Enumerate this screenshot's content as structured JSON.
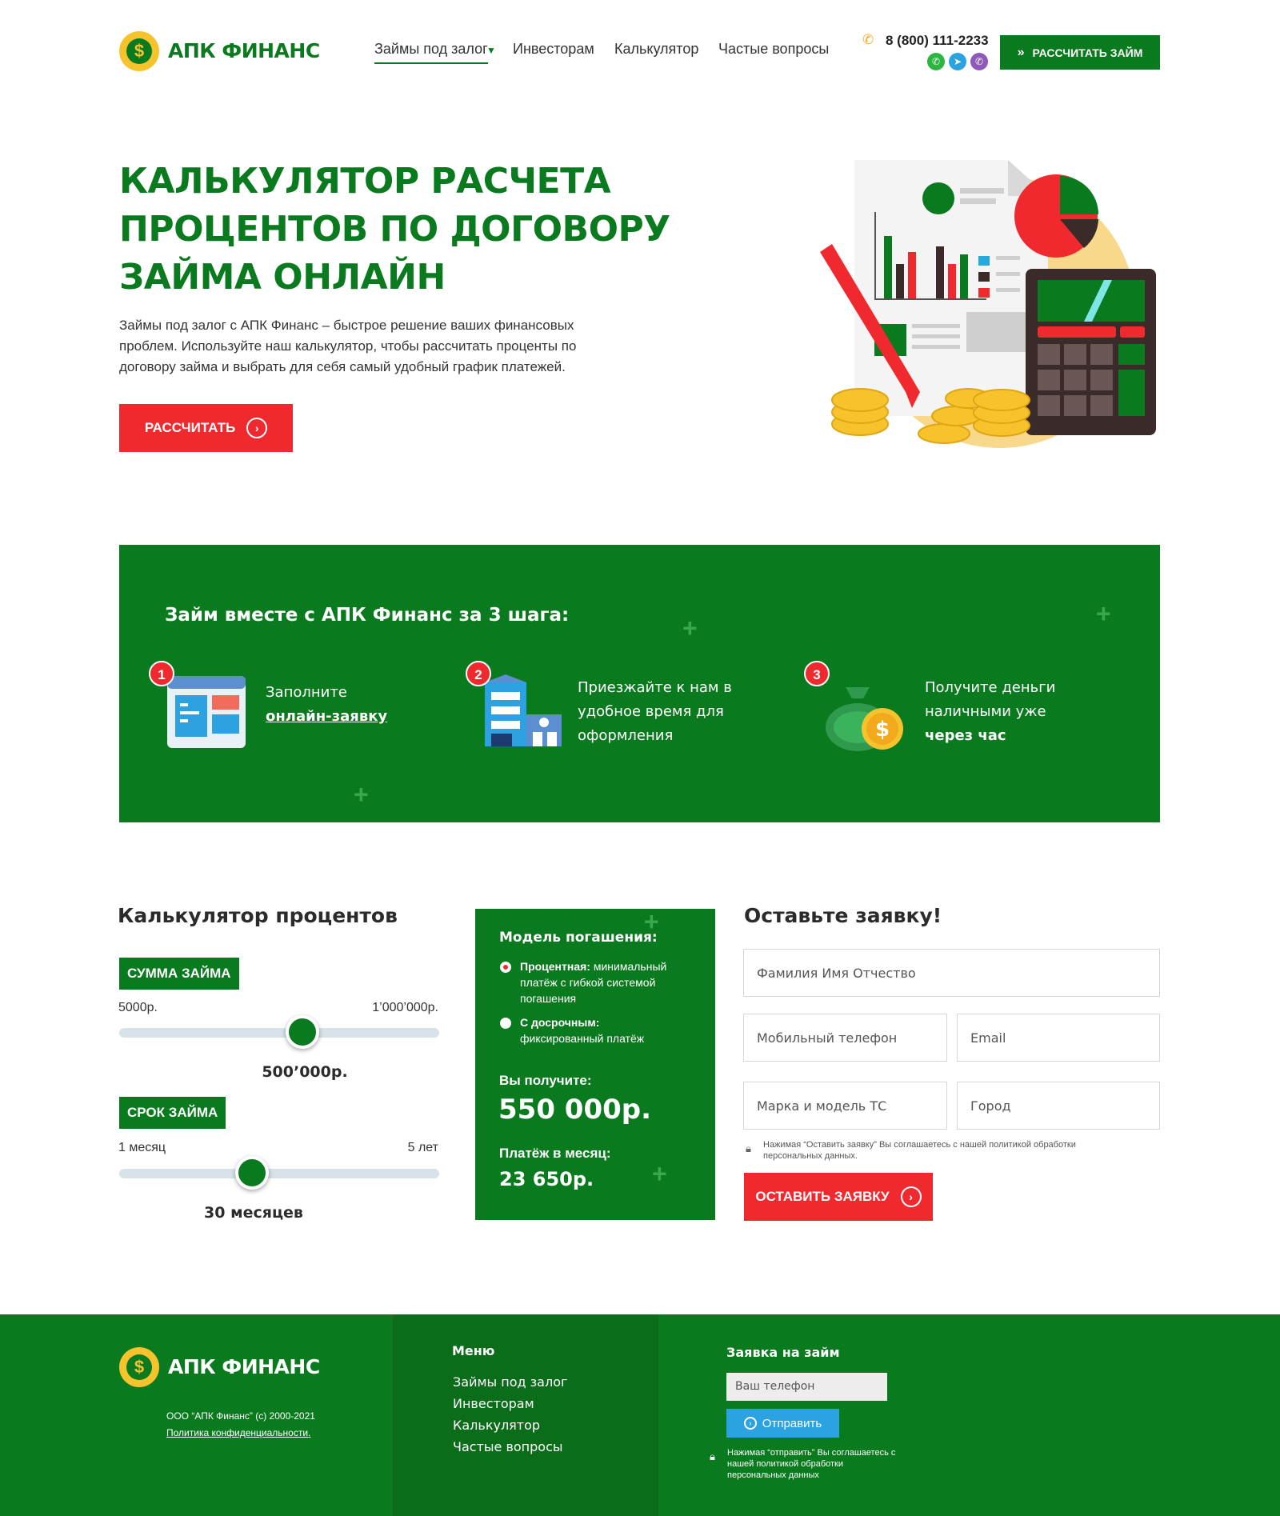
{
  "header": {
    "logo": "АПК ФИНАНС",
    "nav": [
      "Займы под залог",
      "Инвесторам",
      "Калькулятор",
      "Частые вопросы"
    ],
    "phone": "8 (800) 111-2233",
    "cta": "РАССЧИТАТЬ ЗАЙМ"
  },
  "hero": {
    "title_lines": [
      "КАЛЬКУЛЯТОР РАСЧЕТА",
      "ПРОЦЕНТОВ ПО ДОГОВОРУ",
      "ЗАЙМА ОНЛАЙН"
    ],
    "text_lines": [
      "Займы под залог с АПК Финанс – быстрое решение ваших финансовых",
      "проблем. Используйте наш калькулятор, чтобы рассчитать проценты по",
      "договору займа и выбрать для себя самый удобный график платежей."
    ],
    "button": "РАССЧИТАТЬ"
  },
  "steps": {
    "title": "Займ вместе с АПК Финанс за 3 шага:",
    "items": [
      {
        "num": "1",
        "line1": "Заполните",
        "link": "онлайн-заявку"
      },
      {
        "num": "2",
        "line1": "Приезжайте к нам в",
        "line2": "удобное время для",
        "line3": "оформления"
      },
      {
        "num": "3",
        "line1": "Получите деньги",
        "line2": "наличными уже",
        "bold": "через час"
      }
    ]
  },
  "calculator": {
    "title": "Калькулятор процентов",
    "amount": {
      "label": "СУММА ЗАЙМА",
      "min": "5000р.",
      "max": "1’000’000р.",
      "value": "500’000р.",
      "fraction": 0.5
    },
    "term": {
      "label": "СРОК ЗАЙМА",
      "min": "1 месяц",
      "max": "5 лет",
      "value": "30 месяцев",
      "fraction": 0.42
    }
  },
  "panel": {
    "title": "Модель погашения:",
    "option1_bold": "Процентная:",
    "option1_lines": [
      "минимальный",
      "платёж с гибкой системой",
      "погашения"
    ],
    "option2_bold": "С досрочным:",
    "option2_text": "фиксированный платёж",
    "receive_label": "Вы получите:",
    "receive_value": "550 000р.",
    "monthly_label": "Платёж в месяц:",
    "monthly_value": "23 650р."
  },
  "form": {
    "title": "Оставьте заявку!",
    "fio": "Фамилия Имя Отчество",
    "phone": "Мобильный телефон",
    "email": "Email",
    "car": "Марка и модель ТС",
    "city": "Город",
    "note_line1": "Нажимая “Оставить заявку” Вы соглашаетесь с нашей политикой обработки",
    "note_line2": "персональных данных.",
    "submit": "ОСТАВИТЬ ЗАЯВКУ"
  },
  "footer": {
    "logo": "АПК ФИНАНС",
    "copyright": "ООО “АПК Финанс” (с) 2000-2021",
    "privacy": "Политика конфиденциальности.",
    "menu_title": "Меню",
    "menu": [
      "Займы под залог",
      "Инвесторам",
      "Калькулятор",
      "Частые вопросы"
    ],
    "apply_title": "Заявка на займ",
    "phone_placeholder": "Ваш телефон",
    "send": "Отправить",
    "note_lines": [
      "Нажимая “отправить” Вы соглашаетесь с",
      "нашей политикой обработки",
      "персональных данных"
    ]
  },
  "colors": {
    "brand_green": "#0a7a1e",
    "accent_red": "#f0292f",
    "gold": "#f7c32c",
    "telegram": "#2aa3e0"
  },
  "icons": [
    "dollar-bag-icon",
    "phone-icon",
    "whatsapp-icon",
    "telegram-icon",
    "viber-icon",
    "double-chevron-icon",
    "arrow-circle-icon",
    "lock-icon",
    "form-icon",
    "building-icon",
    "money-bag-icon"
  ]
}
